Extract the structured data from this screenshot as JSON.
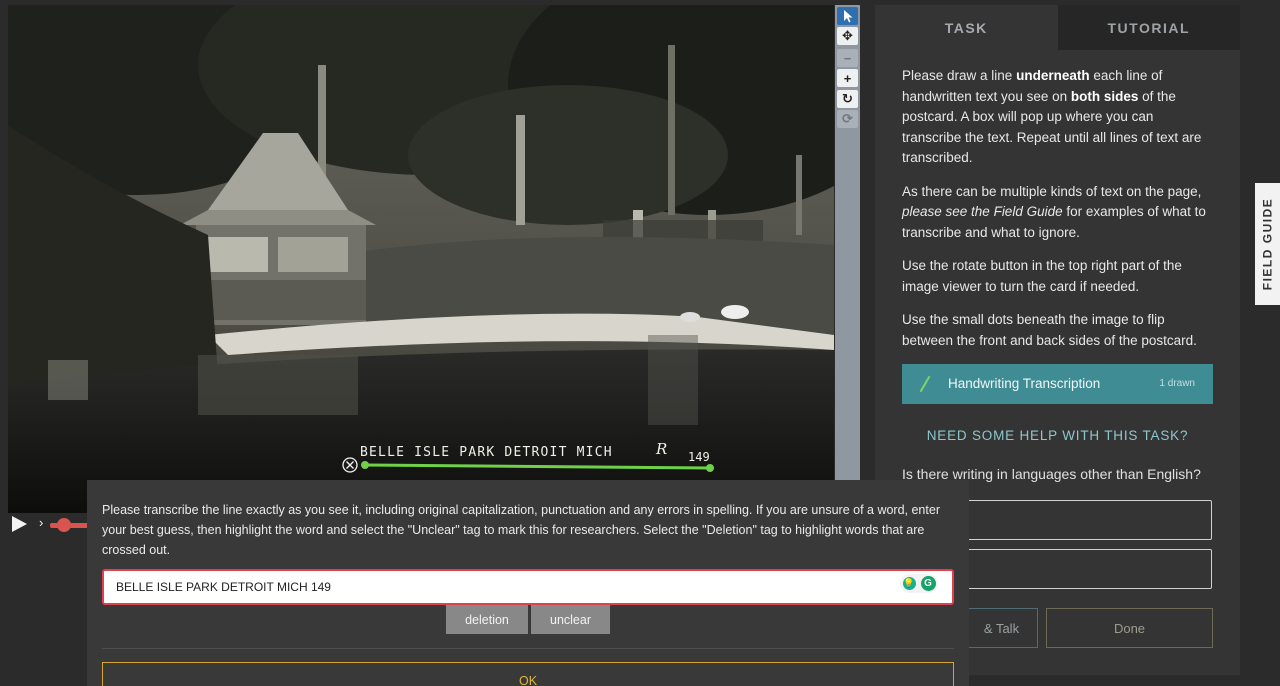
{
  "viewer": {
    "caption": "BELLE ISLE PARK DETROIT MICH",
    "caption_mark": "R",
    "caption_number": "149",
    "remove_mark_icon": "close-circle-icon"
  },
  "toolbar": {
    "tools": [
      "pointer-icon",
      "move-icon",
      "zoom-out-icon",
      "zoom-in-icon",
      "rotate-icon",
      "reset-icon"
    ]
  },
  "panel": {
    "tabs": [
      {
        "label": "TASK"
      },
      {
        "label": "TUTORIAL"
      }
    ],
    "instructions": {
      "p1_a": "Please draw a line ",
      "p1_b": "underneath",
      "p1_c": " each line of handwritten text you see on ",
      "p1_d": "both sides",
      "p1_e": " of the postcard. A box will pop up where you can transcribe the text. Repeat until all lines of text are transcribed.",
      "p2_a": "As there can be multiple kinds of text on the page, ",
      "p2_b": "please see the Field Guide",
      "p2_c": " for examples of what to transcribe and what to ignore.",
      "p3": "Use the rotate button in the top right part of the image viewer to turn the card if needed.",
      "p4": "Use the small dots beneath the image to flip between the front and back sides of the postcard."
    },
    "tool_choice": {
      "label": "Handwriting Transcription",
      "count": "1 drawn"
    },
    "help_link": "NEED SOME HELP WITH THIS TASK?",
    "question": "Is there writing in languages other than English?",
    "talk_label": "& Talk",
    "done_label": "Done"
  },
  "field_guide": {
    "label": "FIELD GUIDE"
  },
  "popup": {
    "instructions": "Please transcribe the line exactly as you see it, including original capitalization, punctuation and any errors in spelling. If you are unsure of a word, enter your best guess, then highlight the word and select the \"Unclear\" tag to mark this for researchers. Select the \"Deletion\" tag to highlight words that are crossed out.",
    "input_value": "BELLE ISLE PARK DETROIT MICH 149",
    "tags": [
      {
        "label": "deletion"
      },
      {
        "label": "unclear"
      }
    ],
    "ok_label": "OK"
  }
}
